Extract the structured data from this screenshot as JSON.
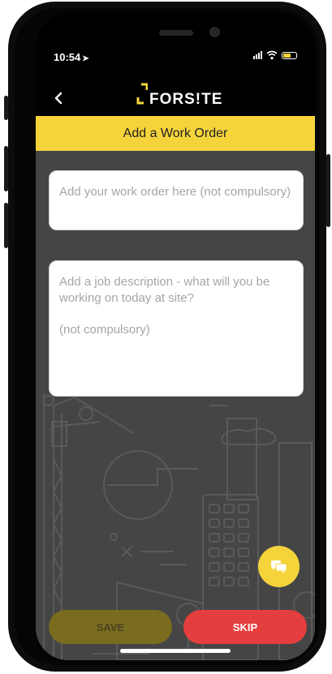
{
  "status_bar": {
    "time": "10:54",
    "location_arrow": "➤"
  },
  "header": {
    "brand": "FORS!TE",
    "title": "Add a Work Order",
    "accent_color": "#f5d33b"
  },
  "form": {
    "work_order_placeholder": "Add your work order here (not compulsory)",
    "job_description_placeholder": "Add a job description - what will you be working on today at site?\n\n(not compulsory)"
  },
  "actions": {
    "save_label": "SAVE",
    "skip_label": "SKIP",
    "skip_color": "#e53e3e"
  },
  "icons": {
    "back": "chevron-left-icon",
    "chat": "chat-bubbles-icon"
  }
}
